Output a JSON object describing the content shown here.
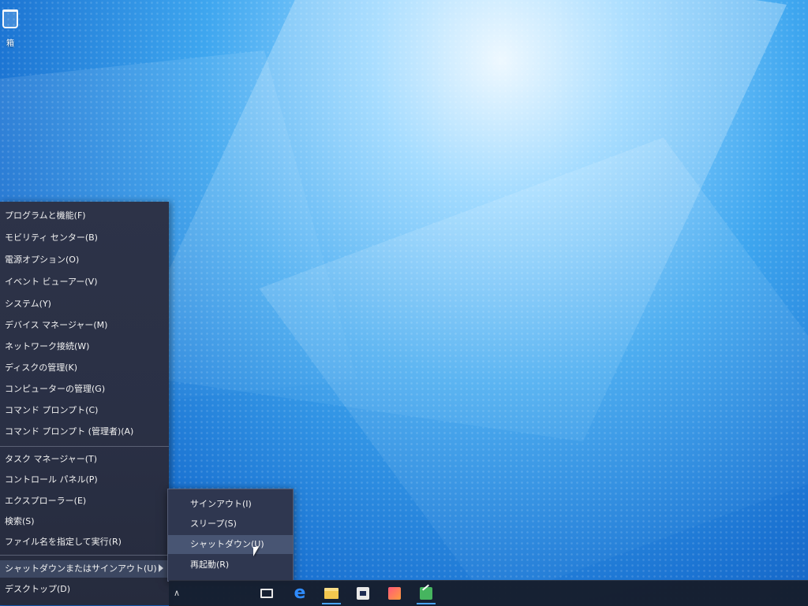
{
  "desktop": {
    "recycle_bin_label": "箱"
  },
  "power_menu": {
    "items": [
      {
        "label": "プログラムと機能(F)"
      },
      {
        "label": "モビリティ センター(B)"
      },
      {
        "label": "電源オプション(O)"
      },
      {
        "label": "イベント ビューアー(V)"
      },
      {
        "label": "システム(Y)"
      },
      {
        "label": "デバイス マネージャー(M)"
      },
      {
        "label": "ネットワーク接続(W)"
      },
      {
        "label": "ディスクの管理(K)"
      },
      {
        "label": "コンピューターの管理(G)"
      },
      {
        "label": "コマンド プロンプト(C)"
      },
      {
        "label": "コマンド プロンプト (管理者)(A)"
      },
      {
        "label": "タスク マネージャー(T)"
      },
      {
        "label": "コントロール パネル(P)"
      },
      {
        "label": "エクスプローラー(E)"
      },
      {
        "label": "検索(S)"
      },
      {
        "label": "ファイル名を指定して実行(R)"
      },
      {
        "label": "シャットダウンまたはサインアウト(U)"
      },
      {
        "label": "デスクトップ(D)"
      }
    ]
  },
  "submenu": {
    "items": [
      {
        "label": "サインアウト(I)"
      },
      {
        "label": "スリープ(S)"
      },
      {
        "label": "シャットダウン(U)"
      },
      {
        "label": "再起動(R)"
      }
    ]
  },
  "taskbar": {
    "caret": "∧",
    "edge_glyph": "e",
    "icons": [
      "task-view-icon",
      "edge-icon",
      "file-explorer-icon",
      "store-icon",
      "photos-icon",
      "chart-app-icon"
    ]
  }
}
